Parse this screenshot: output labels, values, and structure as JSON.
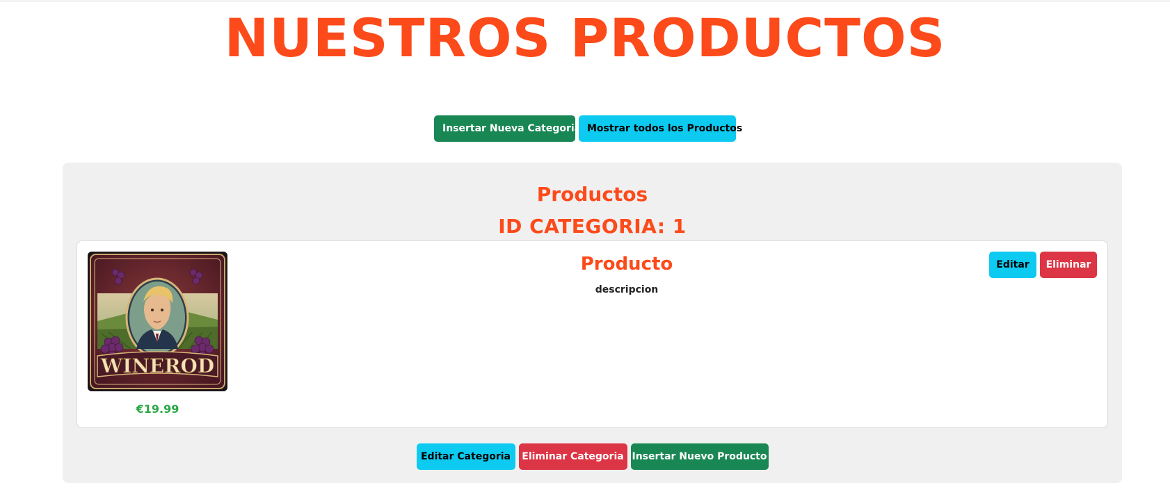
{
  "header": {
    "title": "NUESTROS PRODUCTOS"
  },
  "top_actions": {
    "insert_category_label": "Insertar Nueva Categoria",
    "show_all_label": "Mostrar todos los Productos"
  },
  "category": {
    "heading": "Productos",
    "id_label": "ID CATEGORIA: 1",
    "products": [
      {
        "name": "Producto",
        "description": "descripcion",
        "price": "€19.99",
        "image_label": "WINEROD",
        "edit_label": "Editar",
        "delete_label": "Eliminar"
      }
    ],
    "footer": {
      "edit_category_label": "Editar Categoria",
      "delete_category_label": "Eliminar Categoria",
      "insert_product_label": "Insertar Nuevo Producto"
    }
  },
  "colors": {
    "accent_orange": "#fc4a1a",
    "success_green": "#198754",
    "info_cyan": "#0dcaf0",
    "danger_red": "#dc3545",
    "price_green": "#28a745",
    "panel_bg": "#f0f0f0"
  }
}
